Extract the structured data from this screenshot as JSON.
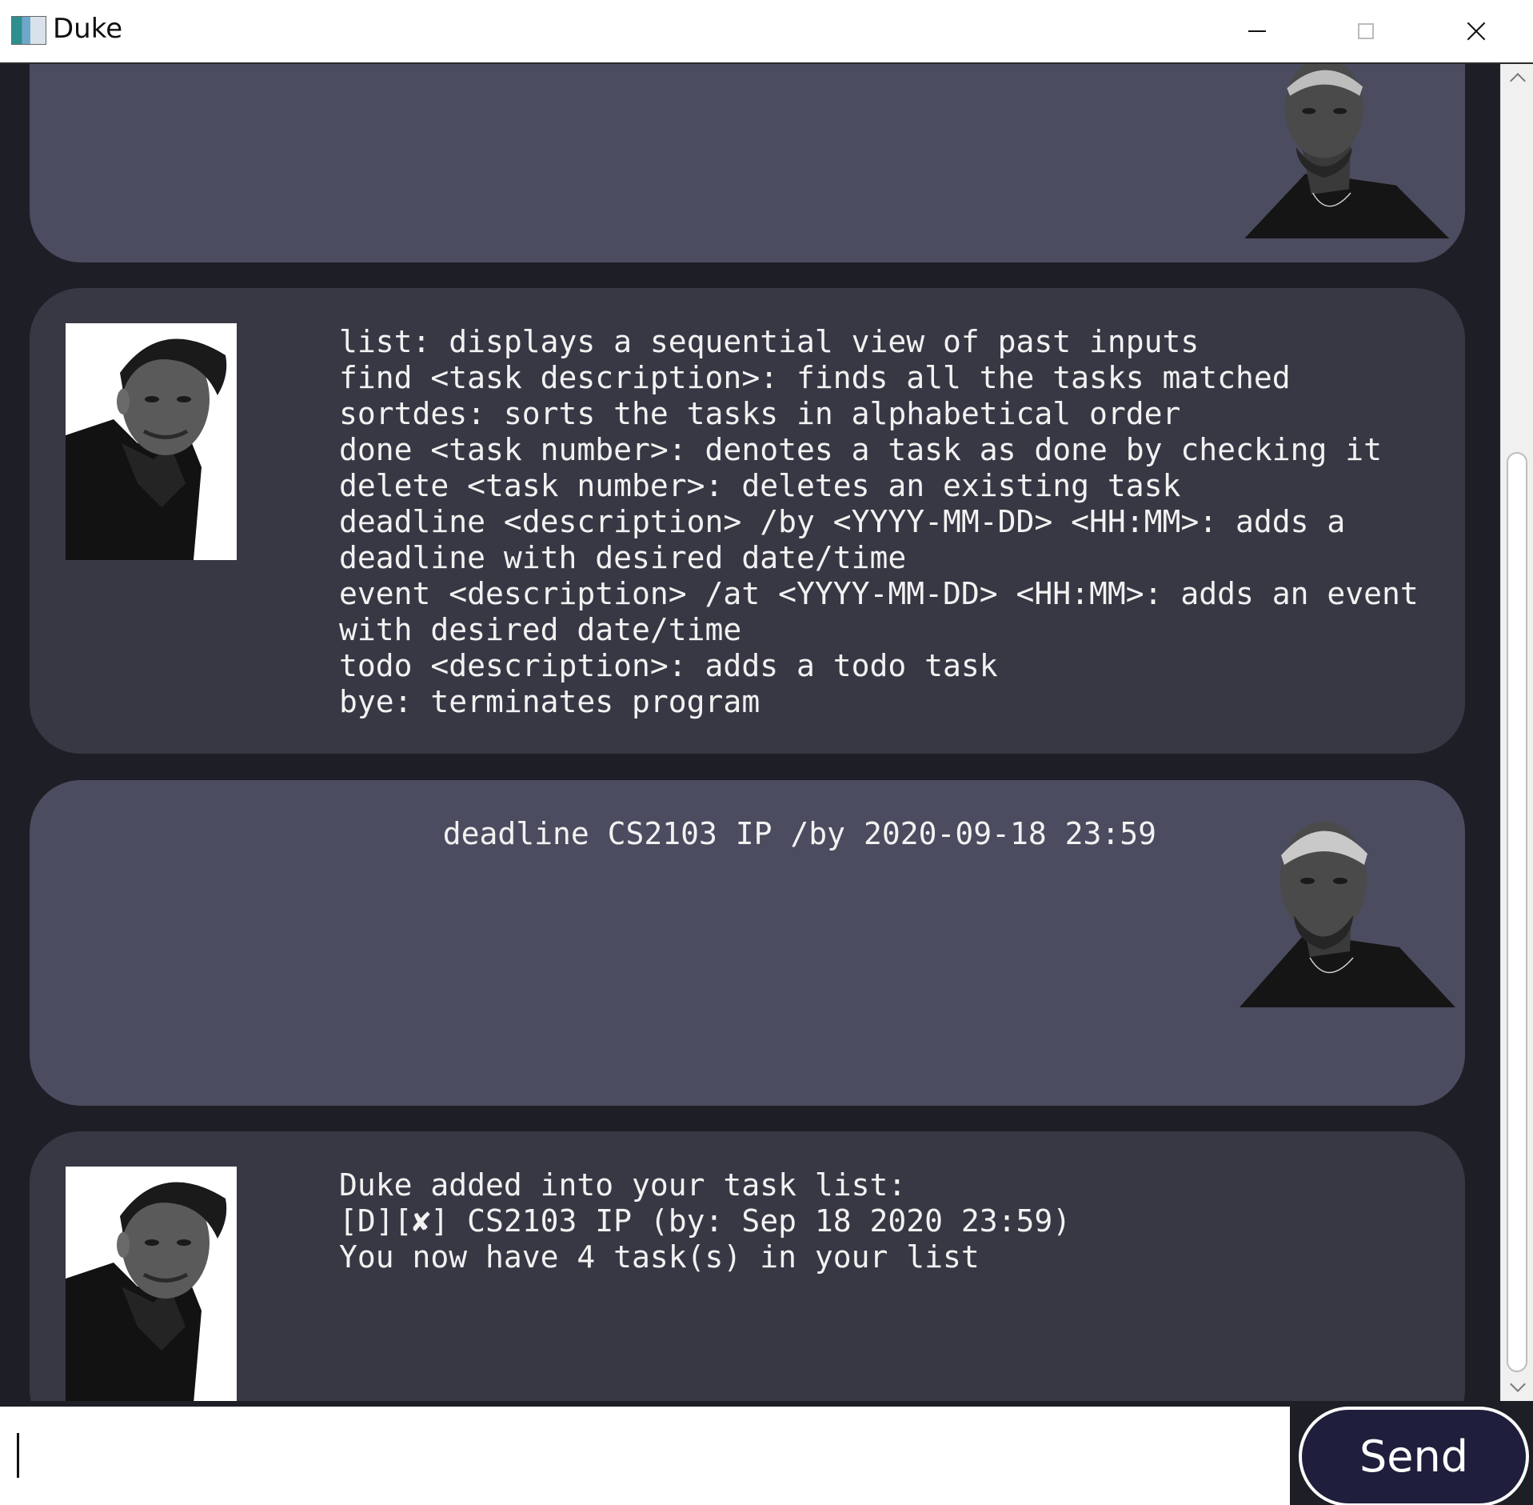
{
  "window": {
    "title": "Duke",
    "app_icon": "duke-app-icon"
  },
  "colors": {
    "background": "#1e1f26",
    "user_bubble": "#4b4c5f",
    "duke_bubble": "#383845",
    "text": "#f2f2f2",
    "send_button": "#1f1e3c"
  },
  "messages": {
    "m0": {
      "sender": "user",
      "text": ""
    },
    "m1": {
      "sender": "duke",
      "text": "list: displays a sequential view of past inputs\nfind <task description>: finds all the tasks matched\nsortdes: sorts the tasks in alphabetical order\ndone <task number>: denotes a task as done by checking it\ndelete <task number>: deletes an existing task\ndeadline <description> /by <YYYY-MM-DD> <HH:MM>: adds a\ndeadline with desired date/time\nevent <description> /at <YYYY-MM-DD> <HH:MM>: adds an event\nwith desired date/time\ntodo <description>: adds a todo task\nbye: terminates program"
    },
    "m2": {
      "sender": "user",
      "text": "deadline CS2103 IP /by 2020-09-18 23:59"
    },
    "m3": {
      "sender": "duke",
      "text": "Duke added into your task list:\n[D][✘] CS2103 IP (by: Sep 18 2020 23:59)\nYou now have 4 task(s) in your list"
    }
  },
  "input": {
    "value": "",
    "placeholder": ""
  },
  "send": {
    "label": "Send"
  }
}
